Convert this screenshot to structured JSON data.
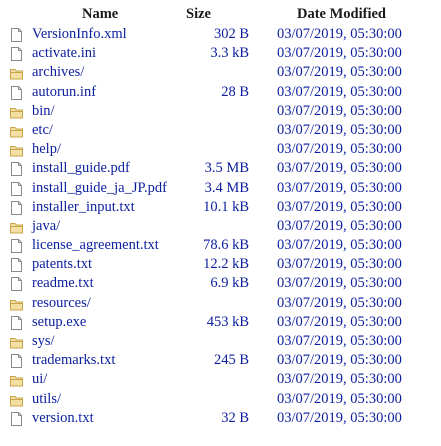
{
  "columns": {
    "name": "Name",
    "size": "Size",
    "date": "Date Modified"
  },
  "colors": {
    "link": "#0b1f9e",
    "file_icon": "#8a8a8a",
    "folder_icon": "#d9b96a"
  },
  "files": [
    {
      "name": "VersionInfo.xml",
      "size": "302 B",
      "date": "03/07/2019, 05:30:00",
      "icon": "file-icon"
    },
    {
      "name": "activate.ini",
      "size": "3.3 kB",
      "date": "03/07/2019, 05:30:00",
      "icon": "file-icon"
    },
    {
      "name": "archives/",
      "size": "",
      "date": "03/07/2019, 05:30:00",
      "icon": "folder-icon"
    },
    {
      "name": "autorun.inf",
      "size": "28 B",
      "date": "03/07/2019, 05:30:00",
      "icon": "file-icon"
    },
    {
      "name": "bin/",
      "size": "",
      "date": "03/07/2019, 05:30:00",
      "icon": "folder-icon"
    },
    {
      "name": "etc/",
      "size": "",
      "date": "03/07/2019, 05:30:00",
      "icon": "folder-icon"
    },
    {
      "name": "help/",
      "size": "",
      "date": "03/07/2019, 05:30:00",
      "icon": "folder-icon"
    },
    {
      "name": "install_guide.pdf",
      "size": "3.5 MB",
      "date": "03/07/2019, 05:30:00",
      "icon": "file-icon"
    },
    {
      "name": "install_guide_ja_JP.pdf",
      "size": "3.4 MB",
      "date": "03/07/2019, 05:30:00",
      "icon": "file-icon"
    },
    {
      "name": "installer_input.txt",
      "size": "10.1 kB",
      "date": "03/07/2019, 05:30:00",
      "icon": "file-icon"
    },
    {
      "name": "java/",
      "size": "",
      "date": "03/07/2019, 05:30:00",
      "icon": "folder-icon"
    },
    {
      "name": "license_agreement.txt",
      "size": "78.6 kB",
      "date": "03/07/2019, 05:30:00",
      "icon": "file-icon"
    },
    {
      "name": "patents.txt",
      "size": "12.2 kB",
      "date": "03/07/2019, 05:30:00",
      "icon": "file-icon"
    },
    {
      "name": "readme.txt",
      "size": "6.9 kB",
      "date": "03/07/2019, 05:30:00",
      "icon": "file-icon"
    },
    {
      "name": "resources/",
      "size": "",
      "date": "03/07/2019, 05:30:00",
      "icon": "folder-icon"
    },
    {
      "name": "setup.exe",
      "size": "453 kB",
      "date": "03/07/2019, 05:30:00",
      "icon": "file-icon"
    },
    {
      "name": "sys/",
      "size": "",
      "date": "03/07/2019, 05:30:00",
      "icon": "folder-icon"
    },
    {
      "name": "trademarks.txt",
      "size": "245 B",
      "date": "03/07/2019, 05:30:00",
      "icon": "file-icon"
    },
    {
      "name": "ui/",
      "size": "",
      "date": "03/07/2019, 05:30:00",
      "icon": "folder-icon"
    },
    {
      "name": "utils/",
      "size": "",
      "date": "03/07/2019, 05:30:00",
      "icon": "folder-icon"
    },
    {
      "name": "version.txt",
      "size": "32 B",
      "date": "03/07/2019, 05:30:00",
      "icon": "file-icon"
    }
  ]
}
